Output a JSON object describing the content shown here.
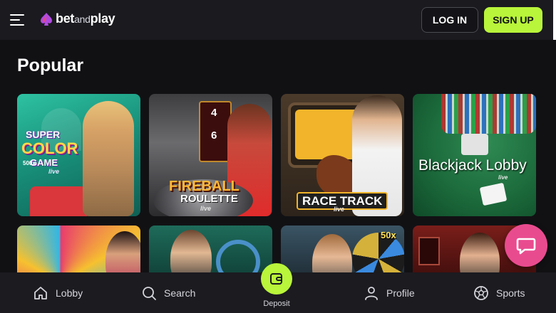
{
  "header": {
    "brand_bet": "bet",
    "brand_and": "and",
    "brand_play": "play",
    "login_label": "LOG IN",
    "signup_label": "SIGN UP",
    "accent_color": "#b9f53a"
  },
  "section": {
    "title": "Popular"
  },
  "games": [
    {
      "label_lines": [
        "SUPER",
        "COLOR",
        "GAME",
        "live"
      ],
      "badge": "500x"
    },
    {
      "label_lines": [
        "FIREBALL",
        "ROULETTE",
        "live"
      ],
      "board_numbers": [
        "4",
        "6"
      ]
    },
    {
      "label_lines": [
        "RACE TRACK",
        "live"
      ]
    },
    {
      "label_lines": [
        "Blackjack Lobby",
        "live"
      ]
    },
    {},
    {},
    {
      "multiplier": "50x"
    },
    {}
  ],
  "chat": {
    "icon": "chat-icon",
    "color": "#e94b8f"
  },
  "bottom_nav": {
    "items": [
      {
        "label": "Lobby",
        "icon": "home-icon"
      },
      {
        "label": "Search",
        "icon": "search-icon"
      },
      {
        "label": "Deposit",
        "icon": "wallet-icon"
      },
      {
        "label": "Profile",
        "icon": "user-icon"
      },
      {
        "label": "Sports",
        "icon": "soccer-ball-icon"
      }
    ]
  }
}
